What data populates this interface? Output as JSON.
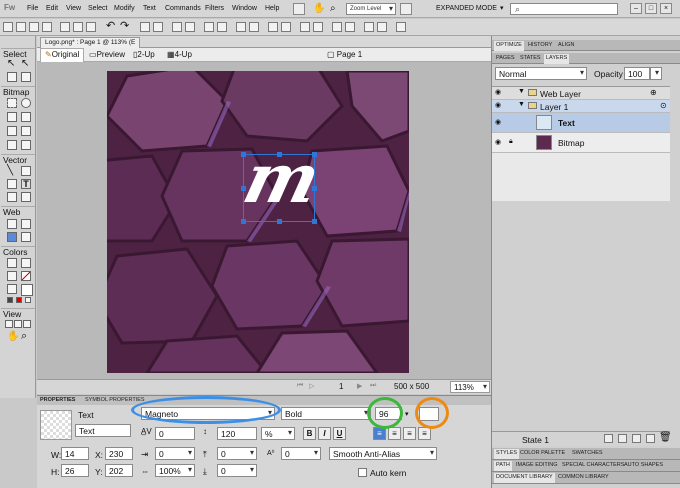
{
  "app": {
    "logo": "Fw"
  },
  "menubar": {
    "items": [
      "File",
      "Edit",
      "View",
      "Select",
      "Modify",
      "Text",
      "Commands",
      "Filters",
      "Window",
      "Help"
    ],
    "zoom_level": "Zoom Level",
    "workspace": "EXPANDED MODE",
    "window_buttons": [
      "–",
      "□",
      "×"
    ]
  },
  "document": {
    "tab_title": "Logo.png* : Page 1 @ 113% (E",
    "views": {
      "original": "Original",
      "preview": "Preview",
      "two_up": "2-Up",
      "four_up": "4-Up"
    },
    "page": "Page 1",
    "page_number": "1",
    "size": "500 x 500",
    "zoom": "113%",
    "artwork_text": "m"
  },
  "tools": {
    "sections": [
      "Select",
      "Bitmap",
      "Vector",
      "Web",
      "Colors",
      "View"
    ]
  },
  "properties": {
    "tabs": [
      "PROPERTIES",
      "SYMBOL PROPERTIES"
    ],
    "object_type": "Text",
    "object_name": "Text",
    "font": "Magneto",
    "style": "Bold",
    "size": "96",
    "kerning": "0",
    "leading": "120",
    "leading_unit": "%",
    "width": "14",
    "height": "26",
    "x": "230",
    "y": "202",
    "indent": "0",
    "scale": "100%",
    "space_before": "0",
    "space_after": "0",
    "baseline": "0",
    "anti_alias": "Smooth Anti-Alias",
    "auto_kern": "Auto kern",
    "labels": {
      "w": "W:",
      "h": "H:",
      "x": "X:",
      "y": "Y:"
    },
    "format": {
      "bold": "B",
      "italic": "I",
      "underline": "U"
    }
  },
  "right_panel": {
    "top_tabs": [
      "OPTIMIZE",
      "HISTORY",
      "ALIGN"
    ],
    "sub_tabs": [
      "PAGES",
      "STATES",
      "LAYERS"
    ],
    "blend_mode": "Normal",
    "opacity_label": "Opacity",
    "opacity": "100",
    "layers": [
      {
        "name": "Web Layer"
      },
      {
        "name": "Layer 1"
      },
      {
        "name": "Text"
      },
      {
        "name": "Bitmap"
      }
    ],
    "state": "State 1",
    "bottom_tabs_1": [
      "STYLES",
      "COLOR PALETTE",
      "SWATCHES"
    ],
    "bottom_tabs_2": [
      "PATH",
      "IMAGE EDITING",
      "SPECIAL CHARACTERS",
      "AUTO SHAPES"
    ],
    "bottom_tabs_3": [
      "DOCUMENT LIBRARY",
      "COMMON LIBRARY"
    ]
  },
  "colors": {
    "accent": "#3d8fe6",
    "ring_green": "#3bb83b",
    "ring_orange": "#ee8a12",
    "hex_fill": "#5b2a4e",
    "selection": "#2f77d6"
  }
}
